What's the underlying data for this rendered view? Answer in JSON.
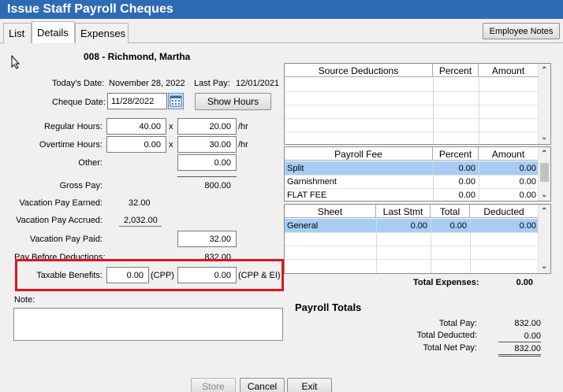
{
  "window": {
    "title": "Issue Staff Payroll Cheques"
  },
  "tabs": [
    {
      "label": "List",
      "active": false
    },
    {
      "label": "Details",
      "active": true
    },
    {
      "label": "Expenses",
      "active": false
    }
  ],
  "employee_notes_button": "Employee Notes",
  "employee_heading": "008 - Richmond, Martha",
  "dates": {
    "today_label": "Today's Date:",
    "today_value": "November 28, 2022",
    "last_pay_label": "Last Pay:",
    "last_pay_value": "12/01/2021",
    "cheque_date_label": "Cheque Date:",
    "cheque_date_value": "11/28/2022"
  },
  "show_hours_button": "Show Hours",
  "pay": {
    "regular_label": "Regular Hours:",
    "regular_hours": "40.00",
    "regular_rate": "20.00",
    "overtime_label": "Overtime Hours:",
    "overtime_hours": "0.00",
    "overtime_rate": "30.00",
    "times": "x",
    "per_hr": "/hr",
    "other_label": "Other:",
    "other_value": "0.00",
    "gross_label": "Gross Pay:",
    "gross_value": "800.00",
    "vac_earned_label": "Vacation Pay Earned:",
    "vac_earned_value": "32.00",
    "vac_accrued_label": "Vacation Pay Accrued:",
    "vac_accrued_value": "2,032.00",
    "vac_paid_label": "Vacation Pay Paid:",
    "vac_paid_value": "32.00",
    "before_ded_label": "Pay Before Deductions:",
    "before_ded_value": "832.00",
    "taxable_label": "Taxable Benefits:",
    "taxable_cpp": "0.00",
    "cpp_label": "(CPP)",
    "taxable_cpp_ei": "0.00",
    "cpp_ei_label": "(CPP & EI)"
  },
  "note_label": "Note:",
  "source_deductions": {
    "headers": [
      "Source Deductions",
      "Percent",
      "Amount"
    ]
  },
  "payroll_fee": {
    "headers": [
      "Payroll Fee",
      "Percent",
      "Amount"
    ],
    "rows": [
      {
        "name": "Split",
        "percent": "0.00",
        "amount": "0.00"
      },
      {
        "name": "Garnishment",
        "percent": "0.00",
        "amount": "0.00"
      },
      {
        "name": "FLAT FEE",
        "percent": "0.00",
        "amount": "0.00"
      }
    ]
  },
  "sheet_table": {
    "headers": [
      "Sheet",
      "Last Stmt",
      "Total",
      "Deducted"
    ],
    "rows": [
      {
        "sheet": "General",
        "last_stmt": "0.00",
        "total": "0.00",
        "deducted": "0.00"
      }
    ]
  },
  "total_expenses_label": "Total Expenses:",
  "total_expenses_value": "0.00",
  "payroll_totals": {
    "heading": "Payroll Totals",
    "total_pay_label": "Total Pay:",
    "total_pay_value": "832.00",
    "total_deducted_label": "Total Deducted:",
    "total_deducted_value": "0.00",
    "total_net_label": "Total Net Pay:",
    "total_net_value": "832.00"
  },
  "footer": {
    "store": "Store",
    "cancel": "Cancel",
    "exit": "Exit"
  },
  "colors": {
    "title_bar": "#2f6ab5",
    "selection": "#a8cdf5",
    "highlight_box": "#e0151c"
  }
}
